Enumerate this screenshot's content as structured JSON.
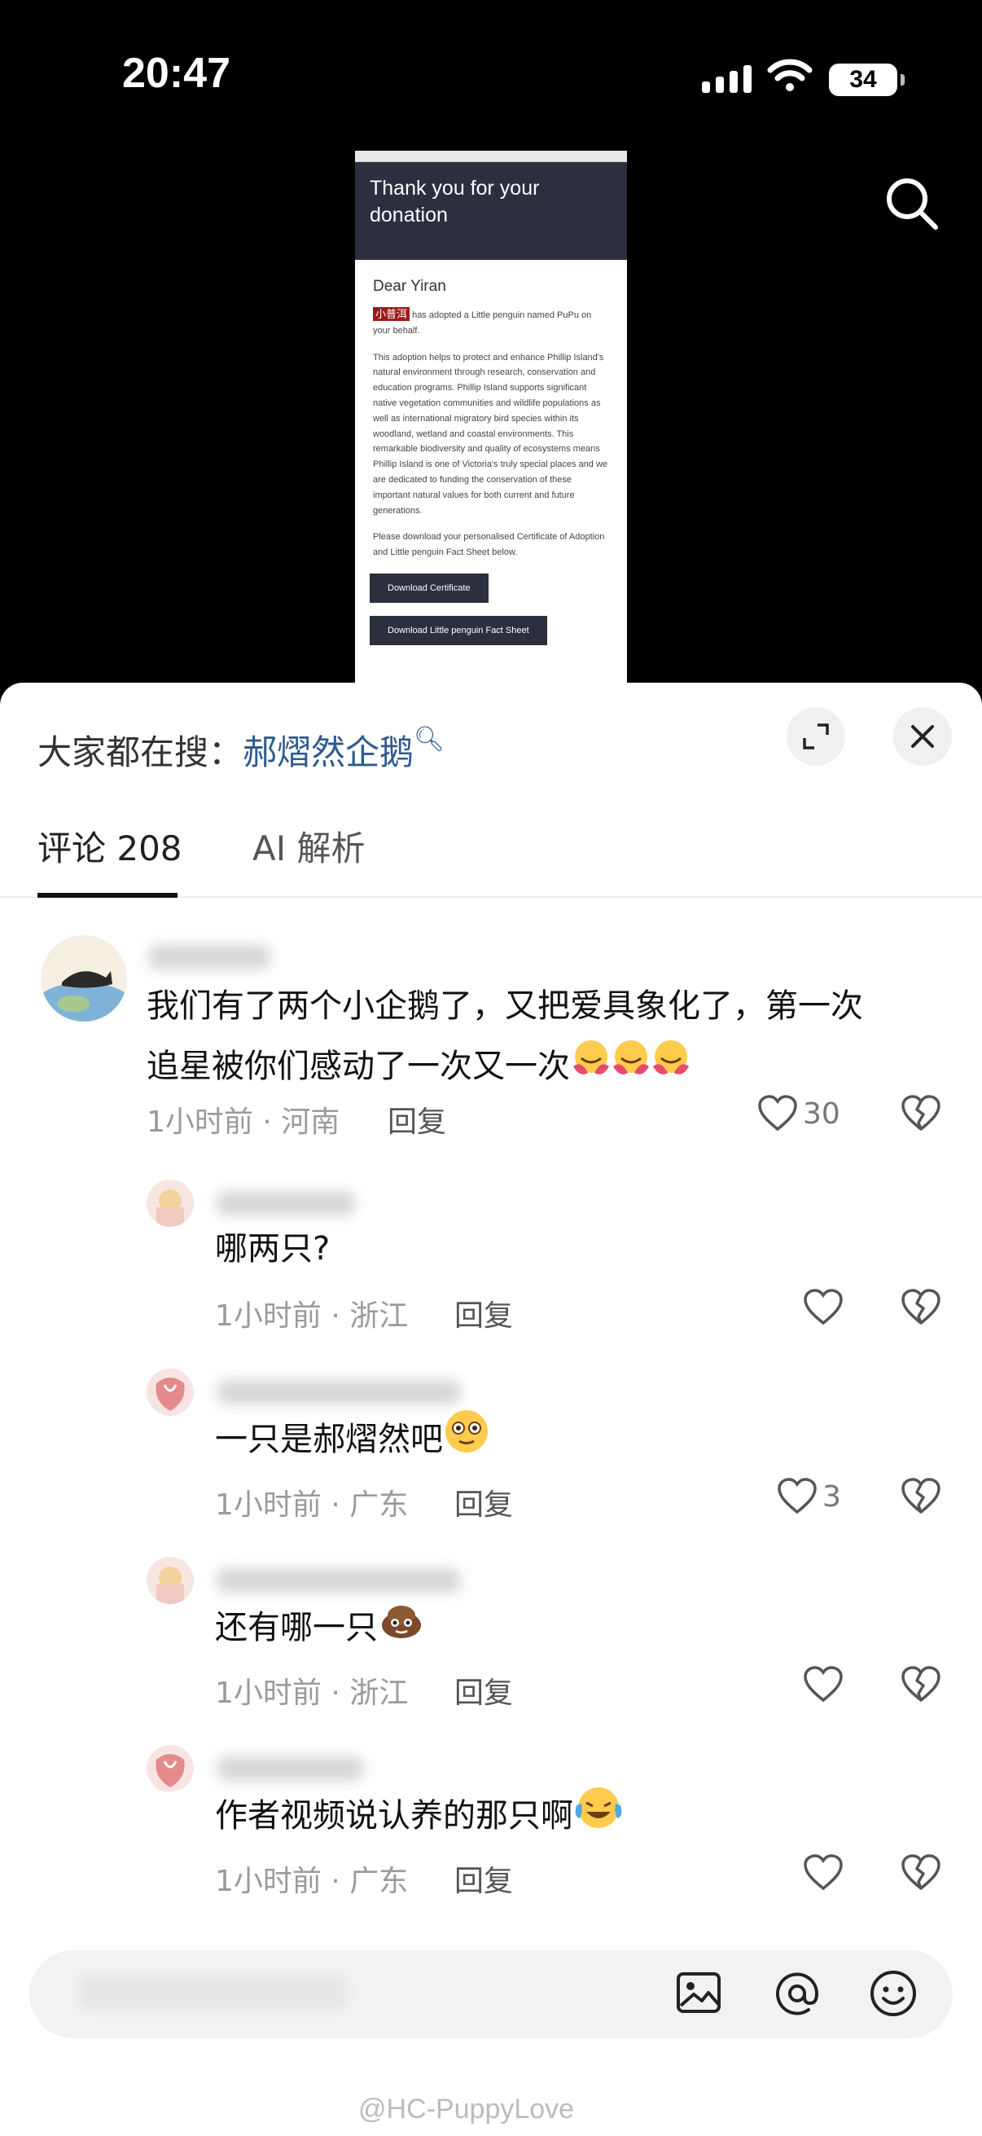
{
  "status_bar": {
    "time": "20:47",
    "battery": "34"
  },
  "email": {
    "header": "Thank you for your donation",
    "dear": "Dear Yiran",
    "adopter_tag": "小普洱",
    "adopt_text": " has adopted a Little penguin named PuPu on your behalf.",
    "paragraph": "This adoption helps to protect and enhance Phillip Island's natural environment through research, conservation and education programs. Phillip Island supports significant native vegetation communities and wildlife populations as well as international migratory bird species within its woodland, wetland and coastal environments. This remarkable biodiversity and quality of ecosystems means Phillip Island is one of Victoria's truly special places and we are dedicated to funding the conservation of these important natural values for both current and future generations.",
    "download_text": "Please download your personalised Certificate of Adoption and Little penguin Fact Sheet below.",
    "btn_certificate": "Download Certificate",
    "btn_factsheet": "Download Little penguin Fact Sheet"
  },
  "sheet": {
    "hot_prefix": "大家都在搜：",
    "hot_term": "郝熠然企鹅",
    "tabs": {
      "comments": "评论 208",
      "ai": "AI 解析"
    }
  },
  "comments": [
    {
      "text_line1": "我们有了两个小企鹅了，又把爱具象化了，第一次",
      "text_line2": "追星被你们感动了一次又一次",
      "meta": "1小时前 · 河南",
      "reply": "回复",
      "likes": "30"
    },
    {
      "text": "哪两只?",
      "meta": "1小时前 · 浙江",
      "reply": "回复",
      "likes": ""
    },
    {
      "text": "一只是郝熠然吧",
      "meta": "1小时前 · 广东",
      "reply": "回复",
      "likes": "3"
    },
    {
      "text": "还有哪一只",
      "meta": "1小时前 · 浙江",
      "reply": "回复",
      "likes": ""
    },
    {
      "text": "作者视频说认养的那只啊",
      "meta": "1小时前 · 广东",
      "reply": "回复",
      "likes": ""
    }
  ],
  "watermark": "@HC-PuppyLove"
}
